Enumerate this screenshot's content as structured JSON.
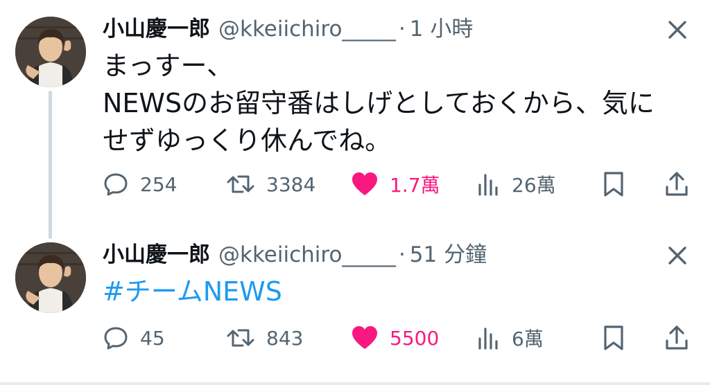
{
  "tweets": [
    {
      "display_name": "小山慶一郎",
      "handle": "@kkeiichiro_____",
      "separator": "·",
      "time": "1 小時",
      "lines": [
        "まっすー、",
        "NEWSのお留守番はしげとしておくから、気に",
        "せずゆっくり休んでね。"
      ],
      "replies": "254",
      "retweets": "3384",
      "likes": "1.7萬",
      "views": "26萬"
    },
    {
      "display_name": "小山慶一郎",
      "handle": "@kkeiichiro_____",
      "separator": "·",
      "time": "51 分鐘",
      "hashtag": "#チームNEWS",
      "replies": "45",
      "retweets": "843",
      "likes": "5500",
      "views": "6萬"
    }
  ],
  "icons": {
    "reply": "speech-bubble-icon",
    "retweet": "retweet-icon",
    "like": "heart-icon",
    "views": "bar-chart-icon",
    "bookmark": "bookmark-icon",
    "share": "share-upload-icon",
    "close": "close-x-icon"
  },
  "colors": {
    "text": "#0f1419",
    "secondary": "#536471",
    "like": "#f91880",
    "hashtag": "#1d9bf0",
    "thread_line": "#cfd9de"
  }
}
